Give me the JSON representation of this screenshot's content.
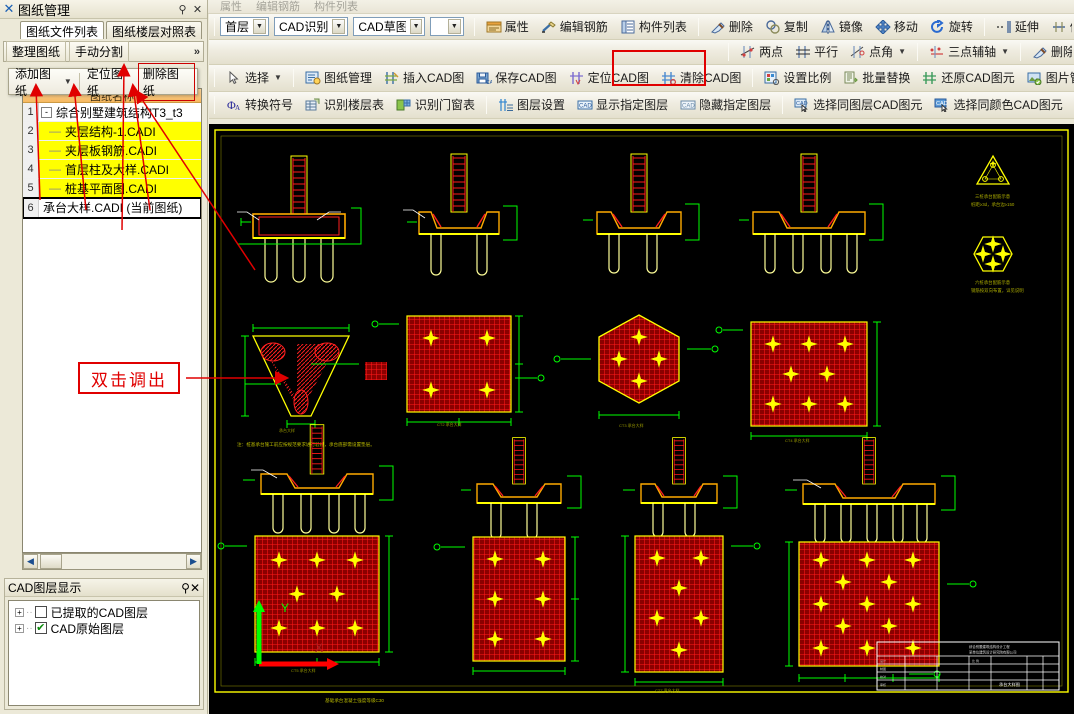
{
  "window": {
    "panel_title": "图纸管理",
    "pin_icon": "pin-icon",
    "close_icon": "close-icon",
    "x_icon": "x-close-icon"
  },
  "ghost_toolbar": [
    "属性",
    "编辑钢筋",
    "构件列表"
  ],
  "ribbon": {
    "row1": {
      "combos": [
        {
          "name": "floor-combo",
          "value": "首层"
        },
        {
          "name": "cad-recognize-combo",
          "value": "CAD识别"
        },
        {
          "name": "cad-sketch-combo",
          "value": "CAD草图"
        },
        {
          "name": "blank-combo",
          "value": ""
        }
      ],
      "buttons": [
        {
          "name": "properties",
          "label": "属性",
          "icon": "properties-icon"
        },
        {
          "name": "edit-rebar",
          "label": "编辑钢筋",
          "icon": "rebar-icon"
        },
        {
          "name": "member-list",
          "label": "构件列表",
          "icon": "list-icon"
        },
        {
          "name": "delete",
          "label": "删除",
          "icon": "eraser-icon"
        },
        {
          "name": "copy",
          "label": "复制",
          "icon": "copy-icon"
        },
        {
          "name": "mirror",
          "label": "镜像",
          "icon": "mirror-icon"
        },
        {
          "name": "move",
          "label": "移动",
          "icon": "move-icon"
        },
        {
          "name": "rotate",
          "label": "旋转",
          "icon": "rotate-icon"
        },
        {
          "name": "extend",
          "label": "延伸",
          "icon": "extend-icon"
        },
        {
          "name": "trim",
          "label": "修剪",
          "icon": "trim-icon"
        }
      ]
    },
    "row2": {
      "buttons": [
        {
          "name": "two-point",
          "label": "两点",
          "icon": "two-point-icon"
        },
        {
          "name": "parallel",
          "label": "平行",
          "icon": "parallel-icon"
        },
        {
          "name": "point-angle",
          "label": "点角",
          "icon": "point-angle-icon",
          "caret": true
        },
        {
          "name": "three-point-axis",
          "label": "三点辅轴",
          "icon": "three-point-axis-icon",
          "caret": true
        },
        {
          "name": "delete-axis",
          "label": "删除",
          "icon": "eraser-icon"
        }
      ]
    },
    "row3": {
      "select": {
        "name": "select-tool",
        "label": "选择",
        "icon": "arrow-cursor-icon",
        "caret": true
      },
      "buttons": [
        {
          "name": "drawing-manage",
          "label": "图纸管理",
          "icon": "drawing-manage-icon"
        },
        {
          "name": "insert-cad",
          "label": "插入CAD图",
          "icon": "insert-cad-icon"
        },
        {
          "name": "save-cad",
          "label": "保存CAD图",
          "icon": "save-cad-icon"
        },
        {
          "name": "locate-cad",
          "label": "定位CAD图",
          "icon": "locate-cad-icon"
        },
        {
          "name": "clear-cad",
          "label": "清除CAD图",
          "icon": "clear-cad-icon",
          "highlight": true
        },
        {
          "name": "set-scale",
          "label": "设置比例",
          "icon": "set-scale-icon"
        },
        {
          "name": "batch-replace",
          "label": "批量替换",
          "icon": "batch-replace-icon"
        },
        {
          "name": "restore-cad-entity",
          "label": "还原CAD图元",
          "icon": "restore-cad-icon"
        },
        {
          "name": "image-manage",
          "label": "图片管理",
          "icon": "image-manage-icon",
          "caret": true
        }
      ]
    },
    "row4": {
      "buttons": [
        {
          "name": "convert-symbol",
          "label": "转换符号",
          "icon": "convert-symbol-icon"
        },
        {
          "name": "recognize-floor-table",
          "label": "识别楼层表",
          "icon": "floor-table-icon"
        },
        {
          "name": "recognize-door-window-table",
          "label": "识别门窗表",
          "icon": "door-window-icon"
        },
        {
          "name": "layer-settings",
          "label": "图层设置",
          "icon": "layer-settings-icon"
        },
        {
          "name": "show-specified-layer",
          "label": "显示指定图层",
          "icon": "cad-layer-icon"
        },
        {
          "name": "hide-specified-layer",
          "label": "隐藏指定图层",
          "icon": "cad-layer-icon"
        },
        {
          "name": "select-same-layer-cad",
          "label": "选择同图层CAD图元",
          "icon": "cad-select-icon"
        },
        {
          "name": "select-same-color-cad",
          "label": "选择同颜色CAD图元",
          "icon": "cad-color-icon"
        }
      ]
    }
  },
  "panel": {
    "tabs": [
      {
        "name": "tab-drawing-file-list",
        "label": "图纸文件列表",
        "selected": true
      },
      {
        "name": "tab-drawing-floor-table",
        "label": "图纸楼层对照表",
        "selected": false
      }
    ],
    "toolbar": [
      {
        "name": "organize-drawings",
        "label": "整理图纸"
      },
      {
        "name": "manual-split",
        "label": "手动分割"
      }
    ],
    "overflow_chevron": "»",
    "float_menu": [
      {
        "name": "add-drawing",
        "label": "添加图纸",
        "caret": true,
        "boxed": false
      },
      {
        "name": "locate-drawing",
        "label": "定位图纸",
        "caret": false,
        "boxed": false
      },
      {
        "name": "delete-drawing",
        "label": "删除图纸",
        "caret": false,
        "boxed": true
      }
    ],
    "grid_header": "图纸名称",
    "rows": [
      {
        "num": "1",
        "label": "综合别墅建筑结构T3_t3",
        "node": "-",
        "highlight": false,
        "indent": 0,
        "boxed": false
      },
      {
        "num": "2",
        "label": "夹层结构-1.CADI",
        "node": "",
        "highlight": true,
        "indent": 1,
        "boxed": false
      },
      {
        "num": "3",
        "label": "夹层板钢筋.CADI",
        "node": "",
        "highlight": true,
        "indent": 1,
        "boxed": false
      },
      {
        "num": "4",
        "label": "首层柱及大样.CADI",
        "node": "",
        "highlight": true,
        "indent": 1,
        "boxed": false
      },
      {
        "num": "5",
        "label": "桩基平面图.CADI",
        "node": "",
        "highlight": true,
        "indent": 1,
        "boxed": false
      },
      {
        "num": "6",
        "label": "承台大样.CADI (当前图纸)",
        "node": "",
        "highlight": false,
        "indent": 0,
        "boxed": true
      }
    ],
    "hscroll": {
      "left_icon": "chevron-left-icon",
      "right_icon": "chevron-right-icon"
    }
  },
  "layer_panel": {
    "title": "CAD图层显示",
    "pin_icon": "pin-icon",
    "close_icon": "close-icon",
    "items": [
      {
        "name": "extracted-cad-layers",
        "label": "已提取的CAD图层",
        "checked": false
      },
      {
        "name": "original-cad-layers",
        "label": "CAD原始图层",
        "checked": true
      }
    ]
  },
  "annotation": {
    "callout_text": "双击调出",
    "color": "#e00000"
  },
  "canvas": {
    "bg_color": "#000000",
    "frame_color": "#ffff00",
    "rebar_color": "#ff0000",
    "dim_color": "#00ff00",
    "outline_color": "#ffff66",
    "axis": {
      "x_label": "X",
      "y_label": "Y",
      "x_color": "#ff0000",
      "y_color": "#00ff00"
    },
    "title_block_label": "承台大样"
  }
}
